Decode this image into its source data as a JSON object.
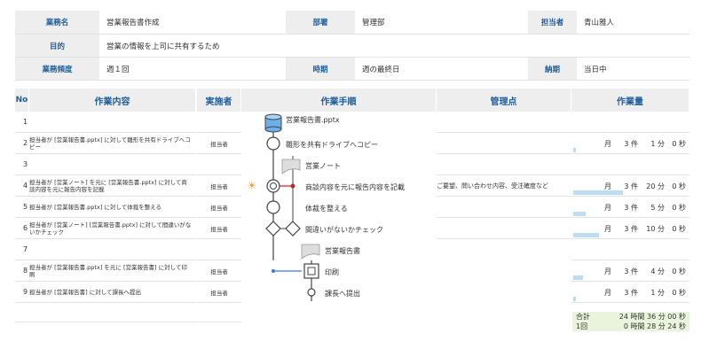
{
  "header": {
    "task_name_label": "業務名",
    "task_name": "営業報告書作成",
    "dept_label": "部署",
    "dept": "管理部",
    "owner_label": "担当者",
    "owner": "青山雅人",
    "purpose_label": "目的",
    "purpose": "営業の情報を上司に共有するため",
    "freq_label": "業務頻度",
    "freq": "週１回",
    "timing_label": "時期",
    "timing": "週の最終日",
    "deadline_label": "納期",
    "deadline": "当日中"
  },
  "columns": {
    "no": "No",
    "content": "作業内容",
    "actor": "実施者",
    "procedure": "作業手順",
    "control": "管理点",
    "volume": "作業量"
  },
  "rows": [
    {
      "no": "1",
      "content": "",
      "actor": ""
    },
    {
      "no": "2",
      "content": "担当者が [営業報告書.pptx] に対して雛形を共有ドライブへコピー",
      "actor": "担当者"
    },
    {
      "no": "3",
      "content": "",
      "actor": ""
    },
    {
      "no": "4",
      "content": "担当者が [営業ノート] を元に [営業報告書.pptx] に対して商談内容を元に報告内容を記載",
      "actor": "担当者"
    },
    {
      "no": "5",
      "content": "担当者が [営業報告書.pptx] に対して体裁を整える",
      "actor": "担当者"
    },
    {
      "no": "6",
      "content": "担当者が [営業ノート] [営業報告書.pptx] に対して間違いがないかチェック",
      "actor": "担当者"
    },
    {
      "no": "7",
      "content": "",
      "actor": ""
    },
    {
      "no": "8",
      "content": "担当者が [営業報告書.pptx] を元に [営業報告書] に対して印刷",
      "actor": "担当者"
    },
    {
      "no": "9",
      "content": "担当者が [営業報告書] に対して課長へ提出",
      "actor": "担当者"
    }
  ],
  "flow": {
    "doc1": "営業報告書.pptx",
    "step2": "雛形を共有ドライブへコピー",
    "doc3": "営業ノート",
    "step4": "商談内容を元に報告内容を記載",
    "step5": "体裁を整える",
    "step6": "間違いがないかチェック",
    "doc7": "営業報告書",
    "step8": "印刷",
    "step9": "課長へ提出",
    "control4": "ご要望、問い合わせ内容、受注確度など"
  },
  "volumes": [
    {
      "row": "2",
      "per": "月",
      "count": "3 件",
      "min": "1 分",
      "sec": "0 秒",
      "fill": 0.02
    },
    {
      "row": "4",
      "per": "月",
      "count": "3 件",
      "min": "20 分",
      "sec": "0 秒",
      "fill": 0.45
    },
    {
      "row": "5",
      "per": "月",
      "count": "3 件",
      "min": "5 分",
      "sec": "0 秒",
      "fill": 0.11
    },
    {
      "row": "6",
      "per": "月",
      "count": "3 件",
      "min": "10 分",
      "sec": "0 秒",
      "fill": 0.23
    },
    {
      "row": "8",
      "per": "月",
      "count": "3 件",
      "min": "4 分",
      "sec": "0 秒",
      "fill": 0.09
    },
    {
      "row": "9",
      "per": "月",
      "count": "3 件",
      "min": "1 分",
      "sec": "0 秒",
      "fill": 0.02
    }
  ],
  "totals": {
    "total_label": "合計",
    "total": "24 時間 36 分 00 秒",
    "once_label": "1回",
    "once": "0 時間 28 分 24 秒"
  }
}
